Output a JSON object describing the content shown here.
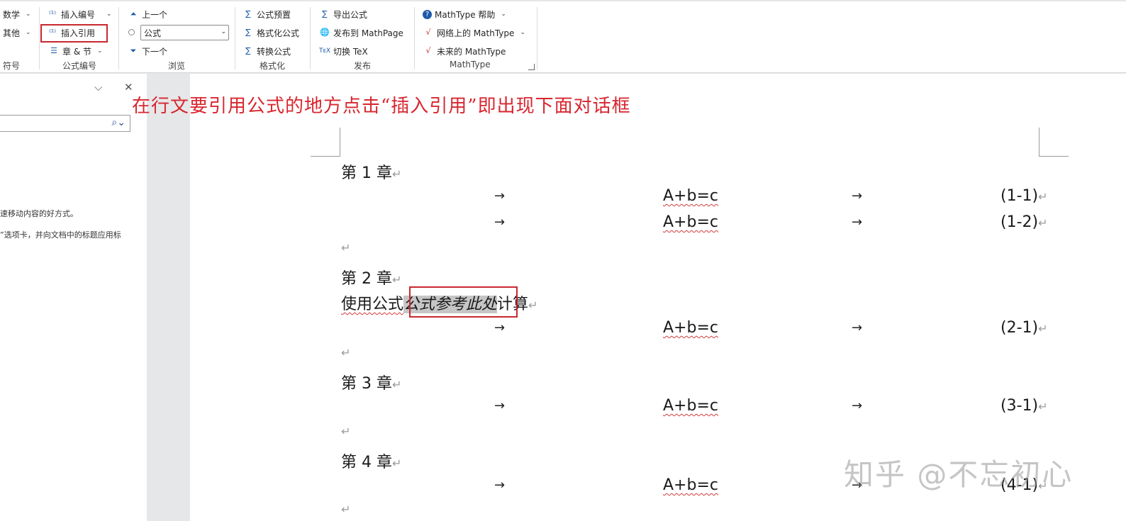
{
  "ribbon": {
    "symbols_group": {
      "math": "数学",
      "other": "其他",
      "label": "符号"
    },
    "numbering_group": {
      "insert_number": "插入编号",
      "insert_reference": "插入引用",
      "chapter_section": "章 & 节",
      "label": "公式编号"
    },
    "browse_group": {
      "prev": "上一个",
      "combo_value": "公式",
      "next": "下一个",
      "label": "浏览"
    },
    "format_group": {
      "presets": "公式预置",
      "format_equations": "格式化公式",
      "convert": "转换公式",
      "label": "格式化"
    },
    "publish_group": {
      "export": "导出公式",
      "publish_mathpage": "发布到 MathPage",
      "toggle_tex": "切换 TeX",
      "label": "发布"
    },
    "mathtype_group": {
      "help": "MathType 帮助",
      "web": "网络上的 MathType",
      "future": "未来的 MathType",
      "label": "MathType"
    }
  },
  "navpane": {
    "text_line1": "速移动内容的好方式。",
    "text_line2": "”选项卡，并向文档中的标题应用标"
  },
  "annotation": "在行文要引用公式的地方点击“插入引用”即出现下面对话框",
  "document": {
    "arrow": "→",
    "para_mark": "↵",
    "chapter1": "第 1 章",
    "chapter2": "第 2 章",
    "chapter3": "第 3 章",
    "chapter4": "第 4 章",
    "equation": "A+b=c",
    "eq_nums": [
      "(1-1)",
      "(1-2)",
      "(2-1)",
      "(3-1)",
      "(4-1)"
    ],
    "sentence_pre": "使用公式",
    "sentence_ref": "公式参考此处",
    "sentence_post": "计算"
  },
  "watermark": "知乎 @不忘初心"
}
